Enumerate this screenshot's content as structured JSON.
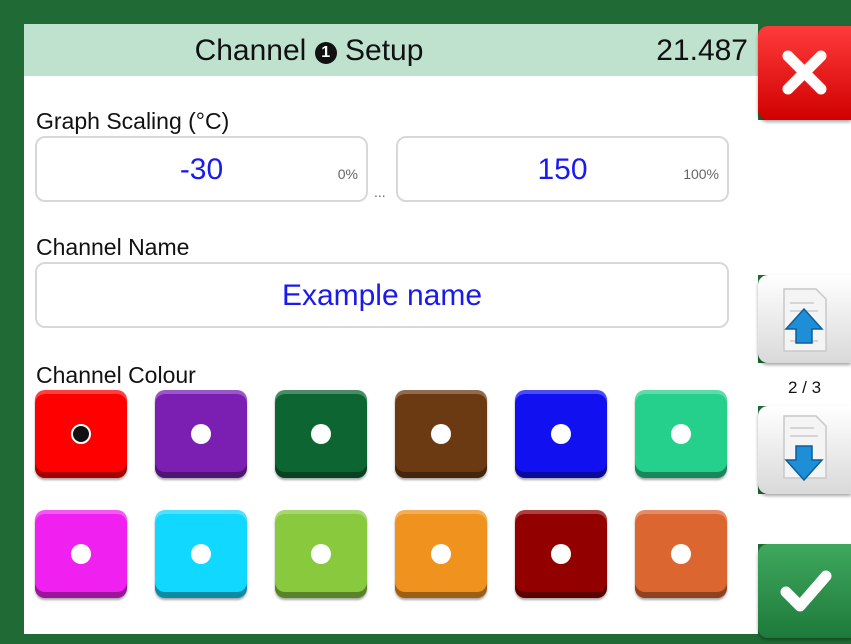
{
  "header": {
    "title_prefix": "Channel",
    "title_number": "1",
    "title_suffix": "Setup",
    "reading": "21.487"
  },
  "graph_scaling": {
    "label": "Graph Scaling (°C)",
    "low_value": "-30",
    "low_tag": "0%",
    "high_value": "150",
    "high_tag": "100%",
    "separator": "..."
  },
  "channel_name": {
    "label": "Channel Name",
    "value": "Example name"
  },
  "channel_colour": {
    "label": "Channel Colour",
    "selected_index": 0,
    "swatches": [
      {
        "name": "red",
        "color": "#ff0000"
      },
      {
        "name": "purple",
        "color": "#7a1fb2"
      },
      {
        "name": "dark-green",
        "color": "#0d6632"
      },
      {
        "name": "brown",
        "color": "#6b3a12"
      },
      {
        "name": "blue",
        "color": "#1010f0"
      },
      {
        "name": "mint",
        "color": "#25d08d"
      },
      {
        "name": "magenta",
        "color": "#f020f0"
      },
      {
        "name": "cyan",
        "color": "#10d8ff"
      },
      {
        "name": "lime",
        "color": "#88c93e"
      },
      {
        "name": "orange",
        "color": "#f0921e"
      },
      {
        "name": "dark-red",
        "color": "#930000"
      },
      {
        "name": "copper",
        "color": "#dc6630"
      }
    ]
  },
  "sidebar": {
    "page_indicator": "2 / 3",
    "close_icon": "close-icon",
    "accept_icon": "checkmark-icon",
    "up_icon": "page-up-icon",
    "down_icon": "page-down-icon"
  }
}
